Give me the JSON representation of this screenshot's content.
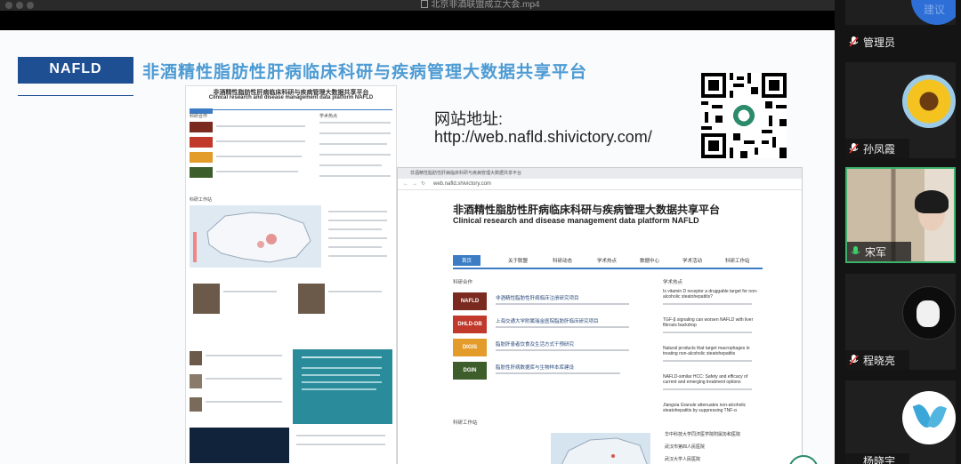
{
  "window": {
    "title": "北京非酒联盟成立大会.mp4",
    "file_icon": "file-icon"
  },
  "slide": {
    "badge": "NAFLD",
    "title": "非酒精性脂肪性肝病临床科研与疾病管理大数据共享平台",
    "site_label": "网站地址:",
    "site_url": "http://web.nafld.shivictory.com/",
    "qr_icon": "qr-code-icon"
  },
  "browser": {
    "address": "web.nafld.shivictory.com",
    "site_title_cn": "非酒精性脂肪性肝病临床科研与疾病管理大数据共享平台",
    "site_title_en": "Clinical research and disease management data platform NAFLD",
    "nav": [
      "首页",
      "关于联盟",
      "科研动态",
      "学术热点",
      "数据中心",
      "学术活动",
      "科研工作站"
    ],
    "section_members": "科研合作",
    "section_hot": "学术热点",
    "section_map": "科研工作站",
    "logos": [
      {
        "text": "NAFLD",
        "color": "#7a2a1e"
      },
      {
        "text": "DHLD-DB",
        "color": "#c0392b"
      },
      {
        "text": "DIGIS",
        "color": "#e39b2a"
      },
      {
        "text": "DGIN",
        "color": "#3d5e2b"
      }
    ],
    "news": [
      "非酒精性脂肪性肝病临床注册研究项目",
      "上海交通大学附属瑞金医院脂肪肝临床研究项目",
      "脂肪肝患者饮食及生活方式干预研究",
      "脂肪性肝病数据库与生物样本库建设"
    ],
    "hot": [
      "Is vitamin D receptor a druggable target for non-alcoholic steatohepatitis?",
      "TGF-β signaling can worsen NAFLD with liver fibrosis backdrop",
      "Natural products that target macrophages in treating non-alcoholic steatohepatitis",
      "NAFLD-similar HCC: Safety and efficacy of current and emerging treatment options",
      "Jiangxia Granule attenuates non-alcoholic steatohepatitis by suppressing TNF-α"
    ],
    "stations": [
      "华中科技大学同济医学院附属协和医院",
      "武汉市第四人民医院",
      "武汉大学人民医院"
    ]
  },
  "participants": [
    {
      "name": "建议",
      "kind": "partial"
    },
    {
      "name": "管理员",
      "kind": "noavatar"
    },
    {
      "name": "孙凤霞",
      "kind": "sunflower"
    },
    {
      "name": "宋军",
      "kind": "video"
    },
    {
      "name": "程晓亮",
      "kind": "silhouette"
    },
    {
      "name": "杨晓宇",
      "kind": "logo"
    }
  ]
}
